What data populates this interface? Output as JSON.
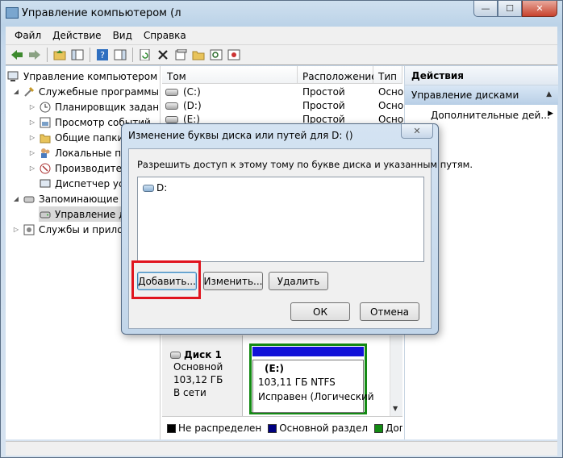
{
  "window": {
    "title": "Управление компьютером (л",
    "minimize_glyph": "—",
    "maximize_glyph": "☐",
    "close_glyph": "✕"
  },
  "menu": [
    "Файл",
    "Действие",
    "Вид",
    "Справка"
  ],
  "toolbar": {
    "icons": [
      "back-icon",
      "forward-icon",
      "up-folder-icon",
      "show-tree-icon",
      "help-icon",
      "properties-pane-icon",
      "refresh-icon",
      "delete-icon",
      "properties-icon",
      "open-icon",
      "search-icon",
      "settings-icon"
    ]
  },
  "tree": {
    "items": [
      {
        "label": "Управление компьютером (л",
        "level": 0,
        "arrow": "",
        "icon": "computer-icon"
      },
      {
        "label": "Служебные программы",
        "level": 1,
        "arrow": "◢",
        "icon": "tools-icon"
      },
      {
        "label": "Планировщик заданий",
        "level": 2,
        "arrow": "▷",
        "icon": "clock-icon"
      },
      {
        "label": "Просмотр событий",
        "level": 2,
        "arrow": "▷",
        "icon": "event-viewer-icon"
      },
      {
        "label": "Общие папки",
        "level": 2,
        "arrow": "▷",
        "icon": "shared-folder-icon"
      },
      {
        "label": "Локальные пол",
        "level": 2,
        "arrow": "▷",
        "icon": "users-icon"
      },
      {
        "label": "Производител",
        "level": 2,
        "arrow": "▷",
        "icon": "performance-icon"
      },
      {
        "label": "Диспетчер устр",
        "level": 2,
        "arrow": "",
        "icon": "device-manager-icon"
      },
      {
        "label": "Запоминающие ус",
        "level": 1,
        "arrow": "◢",
        "icon": "storage-icon"
      },
      {
        "label": "Управление ди",
        "level": 2,
        "arrow": "",
        "icon": "disk-management-icon"
      },
      {
        "label": "Службы и прилож",
        "level": 1,
        "arrow": "▷",
        "icon": "services-icon"
      }
    ]
  },
  "volumes": {
    "columns": [
      "Том",
      "Расположение",
      "Тип"
    ],
    "rows": [
      {
        "name": "(C:)",
        "layout": "Простой",
        "type": "Осно"
      },
      {
        "name": "(D:)",
        "layout": "Простой",
        "type": "Осно"
      },
      {
        "name": "(E:)",
        "layout": "Простой",
        "type": "Осно"
      }
    ]
  },
  "actions": {
    "header": "Действия",
    "section": "Управление дисками",
    "item": "Дополнительные дей..."
  },
  "disk": {
    "name": "Диск 1",
    "kind": "Основной",
    "size": "103,12 ГБ",
    "status": "В сети",
    "partition_label": "(E:)",
    "partition_size": "103,11 ГБ NTFS",
    "partition_status": "Исправен (Логический"
  },
  "legend": [
    {
      "label": "Не распределен",
      "color": "#000000"
    },
    {
      "label": "Основной раздел",
      "color": "#000080"
    },
    {
      "label": "Дополни",
      "color": "#138a13"
    }
  ],
  "dialog": {
    "title": "Изменение буквы диска или путей для D: ()",
    "prompt": "Разрешить доступ к этому тому по букве диска и указанным путям.",
    "list_items": [
      "D:"
    ],
    "add_label": "Добавить...",
    "change_label": "Изменить...",
    "remove_label": "Удалить",
    "ok_label": "ОК",
    "cancel_label": "Отмена",
    "close_glyph": "✕"
  },
  "colors": {
    "highlight": "#e0141e",
    "primary_partition": "#000080",
    "extended_partition": "#138a13"
  }
}
